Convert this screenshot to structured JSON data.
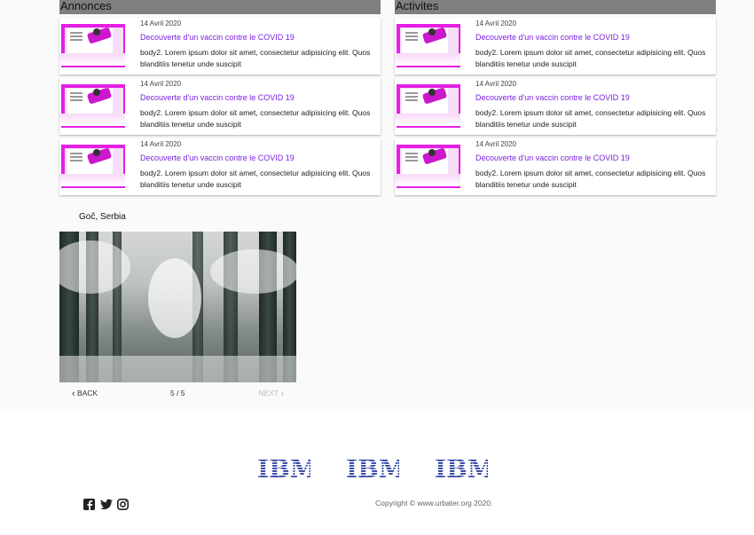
{
  "annonces": {
    "header": "Annonces",
    "cards": [
      {
        "date": "14 Avril 2020",
        "title": "Decouverte d'un vaccin contre le COVID 19",
        "body": "body2. Lorem ipsum dolor sit amet, consectetur adipisicing elit. Quos blanditiis tenetur unde suscipit"
      },
      {
        "date": "14 Avril 2020",
        "title": "Decouverte d'un vaccin contre le COVID 19",
        "body": "body2. Lorem ipsum dolor sit amet, consectetur adipisicing elit. Quos blanditiis tenetur unde suscipit"
      },
      {
        "date": "14 Avril 2020",
        "title": "Decouverte d'un vaccin contre le COVID 19",
        "body": "body2. Lorem ipsum dolor sit amet, consectetur adipisicing elit. Quos blanditiis tenetur unde suscipit"
      }
    ]
  },
  "activites": {
    "header": "Activites",
    "cards": [
      {
        "date": "14 Avril 2020",
        "title": "Decouverte d'un vaccin contre le COVID 19",
        "body": "body2. Lorem ipsum dolor sit amet, consectetur adipisicing elit. Quos blanditiis tenetur unde suscipit"
      },
      {
        "date": "14 Avril 2020",
        "title": "Decouverte d'un vaccin contre le COVID 19",
        "body": "body2. Lorem ipsum dolor sit amet, consectetur adipisicing elit. Quos blanditiis tenetur unde suscipit"
      },
      {
        "date": "14 Avril 2020",
        "title": "Decouverte d'un vaccin contre le COVID 19",
        "body": "body2. Lorem ipsum dolor sit amet, consectetur adipisicing elit. Quos blanditiis tenetur unde suscipit"
      }
    ]
  },
  "slider": {
    "label": "Goč, Serbia",
    "back_label": "BACK",
    "next_label": "NEXT",
    "pager": "5 / 5",
    "current": 5,
    "total": 5
  },
  "footer": {
    "logo_text": "IBM",
    "logo_count": 3,
    "social_icons": [
      "facebook-icon",
      "twitter-icon",
      "instagram-icon"
    ],
    "copyright": "Copyright © www.urbater.org 2020."
  },
  "colors": {
    "header_bg": "#7f7f7f",
    "card_title": "#7b1fe0",
    "thumb_accent": "#e61ee6",
    "ibm_blue": "#3a4ea8"
  }
}
